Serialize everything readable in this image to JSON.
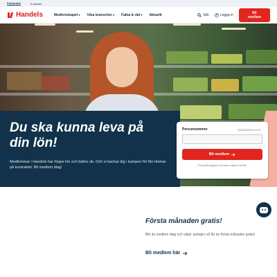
{
  "topbar": {
    "tabs": [
      "Förbundet",
      "A-kassan"
    ]
  },
  "nav": {
    "logo_text": "Handels",
    "menu": [
      "Medlemskapet",
      "Våra branscher",
      "Fakta & råd",
      "Aktuellt"
    ],
    "search_label": "Sök",
    "login_label": "Logga in",
    "cta_label": "Bli medlem"
  },
  "hero": {
    "headline": "Du ska kunna leva på din lön!",
    "body": "Medlemmar i Handels har högre lön och bättre ob. Och vi backar dig i kampen för fler timmar på kontraktet. Bli medlem idag!"
  },
  "form": {
    "label": "Personnummer",
    "hint": "ÅÅÅÅMMDDXXXX",
    "input_value": "",
    "button_label": "Bli medlem",
    "note": "Fixa jobbtrygghet på bara några minuter"
  },
  "promo": {
    "title": "Första månaden gratis!",
    "body": "Blir du medlem idag och väljer autogiro så får du första månaden gratis!",
    "link_label": "Bli medlem här"
  },
  "colors": {
    "brand_red": "#e0261e",
    "navy": "#11324a",
    "accent_pink": "#f4b0a0"
  }
}
